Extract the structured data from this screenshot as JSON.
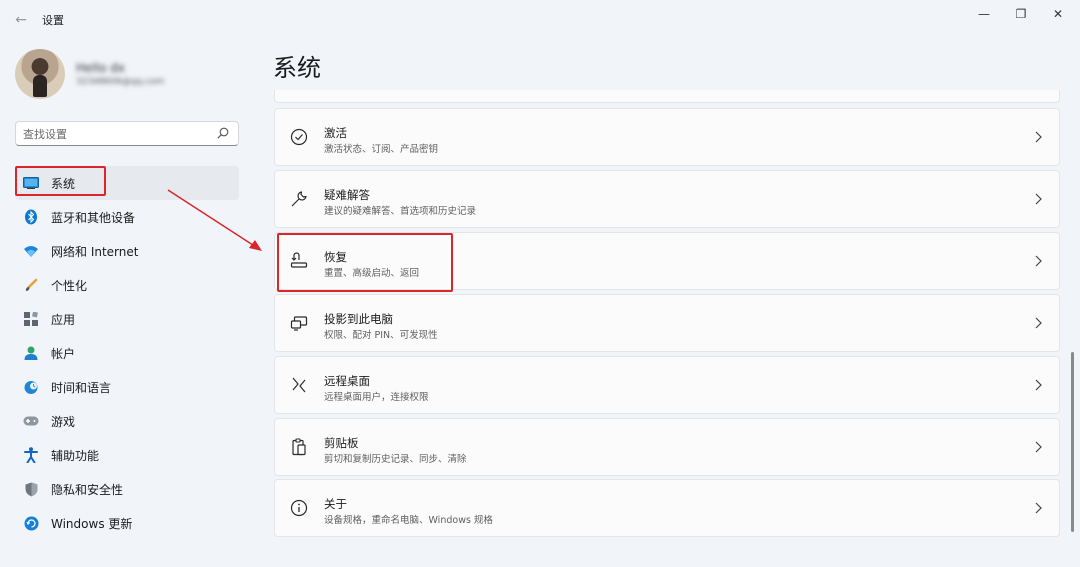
{
  "window": {
    "back_glyph": "←",
    "title": "设置",
    "minimize_glyph": "—",
    "maximize_glyph": "❐",
    "close_glyph": "✕"
  },
  "profile": {
    "name": "Hello dx",
    "email": "32348606@qq.com"
  },
  "search": {
    "placeholder": "查找设置",
    "icon": "search-icon"
  },
  "sidebar": {
    "items": [
      {
        "label": "系统",
        "icon": "system-monitor-icon",
        "selected": true
      },
      {
        "label": "蓝牙和其他设备",
        "icon": "bluetooth-icon"
      },
      {
        "label": "网络和 Internet",
        "icon": "wifi-icon"
      },
      {
        "label": "个性化",
        "icon": "brush-icon"
      },
      {
        "label": "应用",
        "icon": "apps-icon"
      },
      {
        "label": "帐户",
        "icon": "account-icon"
      },
      {
        "label": "时间和语言",
        "icon": "globe-clock-icon"
      },
      {
        "label": "游戏",
        "icon": "gamepad-icon"
      },
      {
        "label": "辅助功能",
        "icon": "accessibility-icon"
      },
      {
        "label": "隐私和安全性",
        "icon": "shield-icon"
      },
      {
        "label": "Windows 更新",
        "icon": "windows-update-icon"
      }
    ]
  },
  "main": {
    "title": "系统",
    "cards": [
      {
        "title": "激活",
        "subtitle": "激活状态、订阅、产品密钥",
        "icon": "check-circle-icon"
      },
      {
        "title": "疑难解答",
        "subtitle": "建议的疑难解答、首选项和历史记录",
        "icon": "wrench-icon"
      },
      {
        "title": "恢复",
        "subtitle": "重置、高级启动、返回",
        "icon": "recovery-icon"
      },
      {
        "title": "投影到此电脑",
        "subtitle": "权限、配对 PIN、可发现性",
        "icon": "project-icon"
      },
      {
        "title": "远程桌面",
        "subtitle": "远程桌面用户，连接权限",
        "icon": "remote-desktop-icon"
      },
      {
        "title": "剪贴板",
        "subtitle": "剪切和复制历史记录、同步、清除",
        "icon": "clipboard-icon"
      },
      {
        "title": "关于",
        "subtitle": "设备规格，重命名电脑、Windows 规格",
        "icon": "info-icon"
      }
    ]
  },
  "colors": {
    "accent": "#0067c0",
    "annotation": "#d9262b",
    "background": "#f1f4f9",
    "card": "#fbfbfc"
  }
}
